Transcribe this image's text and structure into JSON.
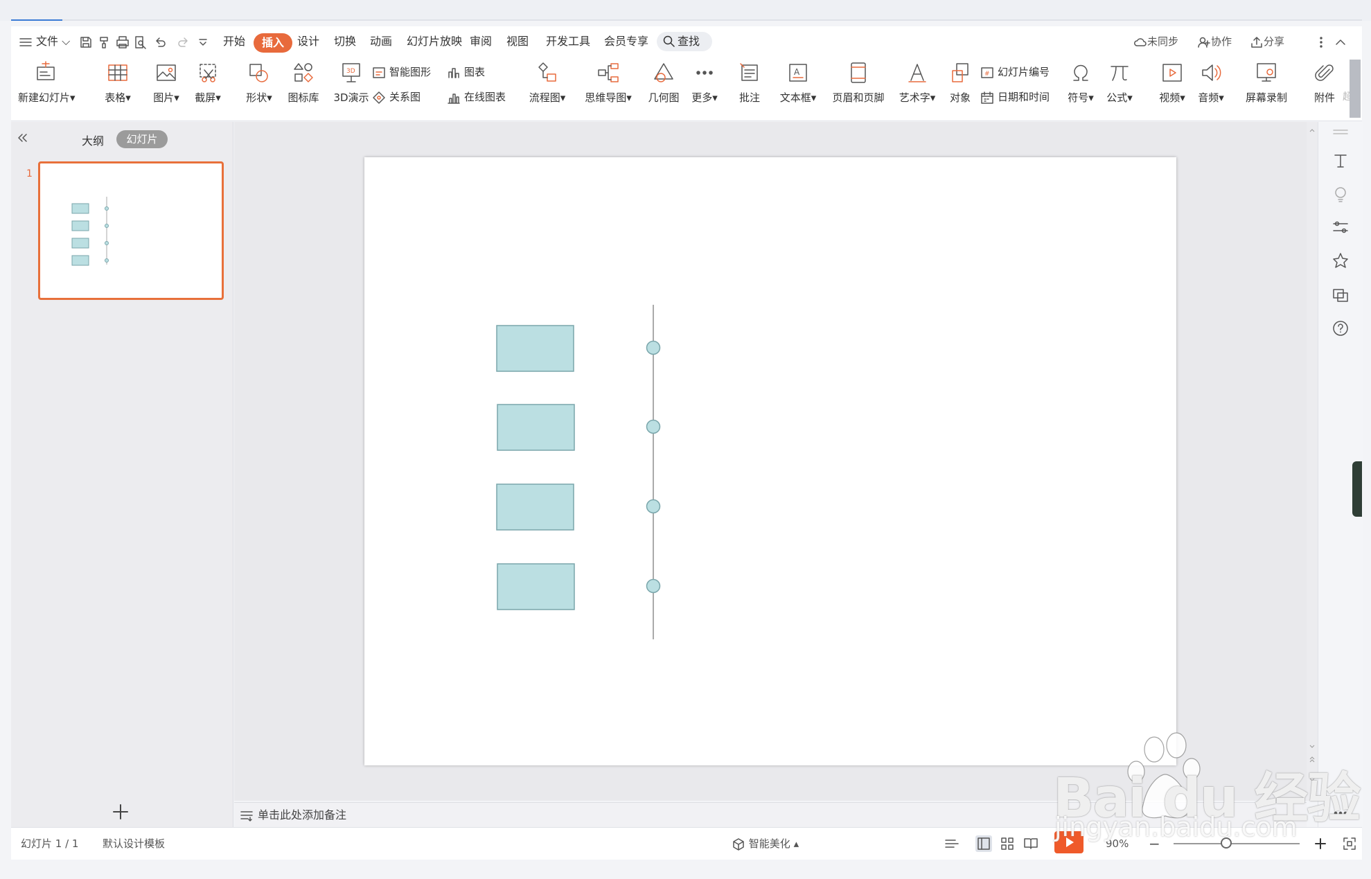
{
  "menu": {
    "file": "文件",
    "tabs": [
      "开始",
      "插入",
      "设计",
      "切换",
      "动画",
      "幻灯片放映",
      "审阅",
      "视图",
      "开发工具",
      "会员专享"
    ],
    "active_tab": "插入",
    "search": "查找",
    "unsynced": "未同步",
    "collaborate": "协作",
    "share": "分享"
  },
  "ribbon": {
    "new_slide": "新建幻灯片",
    "table": "表格",
    "picture": "图片",
    "screenshot": "截屏",
    "shape": "形状",
    "icon_library": "图标库",
    "demo3d": "3D演示",
    "smart_graphic": "智能图形",
    "chart": "图表",
    "relation": "关系图",
    "online_chart": "在线图表",
    "flowchart": "流程图",
    "mindmap": "思维导图",
    "geometry": "几何图",
    "more": "更多",
    "comment": "批注",
    "textbox": "文本框",
    "header_footer": "页眉和页脚",
    "wordart": "艺术字",
    "object": "对象",
    "slide_number": "幻灯片编号",
    "datetime": "日期和时间",
    "symbol": "符号",
    "formula": "公式",
    "video": "视频",
    "audio": "音频",
    "screen_record": "屏幕录制",
    "attachment": "附件",
    "overflow": "超"
  },
  "left_panel": {
    "outline_tab": "大纲",
    "slides_tab": "幻灯片",
    "slide_number": "1"
  },
  "notes_placeholder": "单击此处添加备注",
  "status": {
    "slide_count": "幻灯片 1 / 1",
    "template": "默认设计模板",
    "smart_beautify": "智能美化",
    "zoom": "90%"
  },
  "watermark": {
    "brand": "Bai du 经验",
    "url": "jingyan.baidu.com"
  },
  "colors": {
    "accent": "#e86a3c",
    "shape_fill": "#bbdfe2",
    "shape_stroke": "#7aa6ab",
    "timeline": "#aaaaaa"
  }
}
